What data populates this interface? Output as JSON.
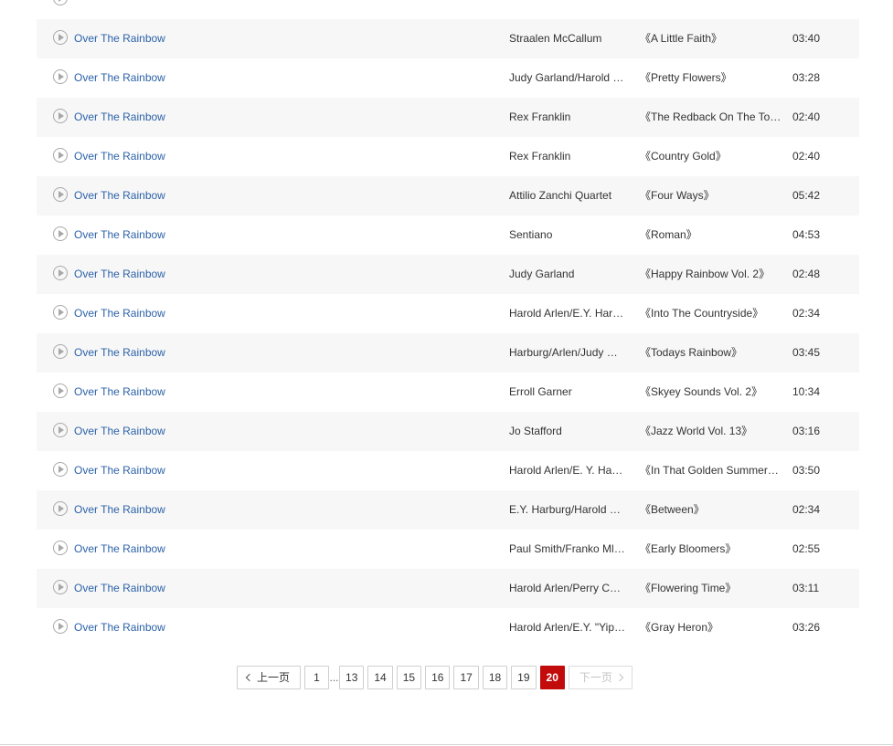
{
  "songs": [
    {
      "title": "",
      "singer": "",
      "album": "",
      "duration": ""
    },
    {
      "title": "Over The Rainbow",
      "singer": "Straalen McCallum",
      "album": "《A Little Faith》",
      "duration": "03:40"
    },
    {
      "title": "Over The Rainbow",
      "singer": "Judy Garland/Harold …",
      "album": "《Pretty Flowers》",
      "duration": "03:28"
    },
    {
      "title": "Over The Rainbow",
      "singer": "Rex Franklin",
      "album": "《The Redback On The To…",
      "duration": "02:40"
    },
    {
      "title": "Over The Rainbow",
      "singer": "Rex Franklin",
      "album": "《Country Gold》",
      "duration": "02:40"
    },
    {
      "title": "Over The Rainbow",
      "singer": "Attilio Zanchi Quartet",
      "album": "《Four Ways》",
      "duration": "05:42"
    },
    {
      "title": "Over The Rainbow",
      "singer": "Sentiano",
      "album": "《Roman》",
      "duration": "04:53"
    },
    {
      "title": "Over The Rainbow",
      "singer": "Judy Garland",
      "album": "《Happy Rainbow Vol. 2》",
      "duration": "02:48"
    },
    {
      "title": "Over The Rainbow",
      "singer": "Harold Arlen/E.Y. Har…",
      "album": "《Into The Countryside》",
      "duration": "02:34"
    },
    {
      "title": "Over The Rainbow",
      "singer": "Harburg/Arlen/Judy …",
      "album": "《Todays Rainbow》",
      "duration": "03:45"
    },
    {
      "title": "Over The Rainbow",
      "singer": "Erroll Garner",
      "album": "《Skyey Sounds Vol. 2》",
      "duration": "10:34"
    },
    {
      "title": "Over The Rainbow",
      "singer": "Jo Stafford",
      "album": "《Jazz World Vol. 13》",
      "duration": "03:16"
    },
    {
      "title": "Over The Rainbow",
      "singer": "Harold Arlen/E. Y. Ha…",
      "album": "《In That Golden Summer…",
      "duration": "03:50"
    },
    {
      "title": "Over The Rainbow",
      "singer": "E.Y. Harburg/Harold …",
      "album": "《Between》",
      "duration": "02:34"
    },
    {
      "title": "Over The Rainbow",
      "singer": "Paul Smith/Franko Ml…",
      "album": "《Early Bloomers》",
      "duration": "02:55"
    },
    {
      "title": "Over The Rainbow",
      "singer": "Harold Arlen/Perry C…",
      "album": "《Flowering Time》",
      "duration": "03:11"
    },
    {
      "title": "Over The Rainbow",
      "singer": "Harold Arlen/E.Y. \"Yip…",
      "album": "《Gray Heron》",
      "duration": "03:26"
    }
  ],
  "pagination": {
    "prev_label": "上一页",
    "next_label": "下一页",
    "first_page": "1",
    "ellipsis": "...",
    "pages": [
      "13",
      "14",
      "15",
      "16",
      "17",
      "18",
      "19"
    ],
    "current_page": "20"
  },
  "colors": {
    "link": "#2c62a8",
    "row_alt": "#f7f7f7",
    "current_page": "#c20c0c"
  },
  "icons": {
    "play": "play-circle-icon",
    "prev": "chevron-left-icon",
    "next": "chevron-right-icon"
  }
}
